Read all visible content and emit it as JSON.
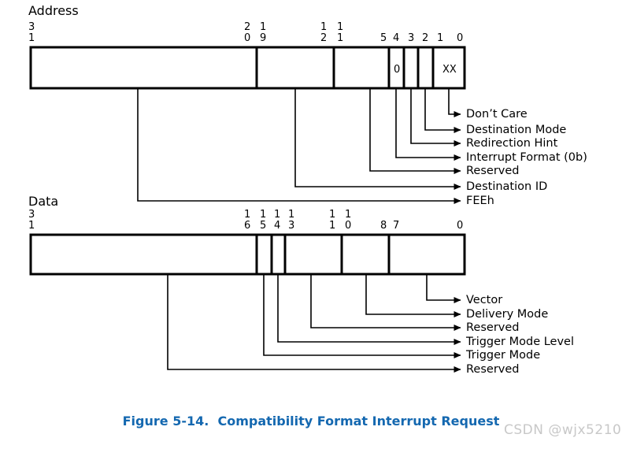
{
  "figure": {
    "caption": "Figure 5-14.  Compatibility Format Interrupt Request",
    "caption_color": "#1468b0",
    "watermark": "CSDN @wjx5210",
    "line_color": "#000000",
    "background": "#ffffff"
  },
  "address": {
    "title": "Address",
    "bit_labels": [
      {
        "top": "3",
        "bottom": "1"
      },
      {
        "top": "2",
        "bottom": "0"
      },
      {
        "top": "1",
        "bottom": "9"
      },
      {
        "top": "1",
        "bottom": "2"
      },
      {
        "top": "1",
        "bottom": "1"
      },
      {
        "top": "",
        "bottom": "5"
      },
      {
        "top": "",
        "bottom": "4"
      },
      {
        "top": "",
        "bottom": "3"
      },
      {
        "top": "",
        "bottom": "2"
      },
      {
        "top": "",
        "bottom": "1"
      },
      {
        "top": "",
        "bottom": "0"
      }
    ],
    "fields": [
      {
        "name": "FEEh",
        "bits": "31:20",
        "value": ""
      },
      {
        "name": "Destination ID",
        "bits": "19:12",
        "value": ""
      },
      {
        "name": "Reserved",
        "bits": "11:5",
        "value": ""
      },
      {
        "name": "Interrupt Format",
        "bits": "4",
        "value": "0"
      },
      {
        "name": "Redirection Hint",
        "bits": "3",
        "value": ""
      },
      {
        "name": "Destination Mode",
        "bits": "2",
        "value": ""
      },
      {
        "name": "Don't Care",
        "bits": "1:0",
        "value": "XX"
      }
    ],
    "callouts": [
      "Don’t Care",
      "Destination Mode",
      "Redirection Hint",
      "Interrupt Format (0b)",
      "Reserved",
      "Destination ID",
      "FEEh"
    ]
  },
  "data": {
    "title": "Data",
    "bit_labels": [
      {
        "top": "3",
        "bottom": "1"
      },
      {
        "top": "1",
        "bottom": "6"
      },
      {
        "top": "1",
        "bottom": "5"
      },
      {
        "top": "1",
        "bottom": "4"
      },
      {
        "top": "1",
        "bottom": "3"
      },
      {
        "top": "1",
        "bottom": "1"
      },
      {
        "top": "1",
        "bottom": "0"
      },
      {
        "top": "",
        "bottom": "8"
      },
      {
        "top": "",
        "bottom": "7"
      },
      {
        "top": "",
        "bottom": "0"
      }
    ],
    "fields": [
      {
        "name": "Reserved",
        "bits": "31:16",
        "value": ""
      },
      {
        "name": "Trigger Mode",
        "bits": "15",
        "value": ""
      },
      {
        "name": "Trigger Mode Level",
        "bits": "14",
        "value": ""
      },
      {
        "name": "Reserved",
        "bits": "13:11",
        "value": ""
      },
      {
        "name": "Delivery Mode",
        "bits": "10:8",
        "value": ""
      },
      {
        "name": "Vector",
        "bits": "7:0",
        "value": ""
      }
    ],
    "callouts": [
      "Vector",
      "Delivery Mode",
      "Reserved",
      "Trigger Mode Level",
      "Trigger Mode",
      "Reserved"
    ]
  }
}
